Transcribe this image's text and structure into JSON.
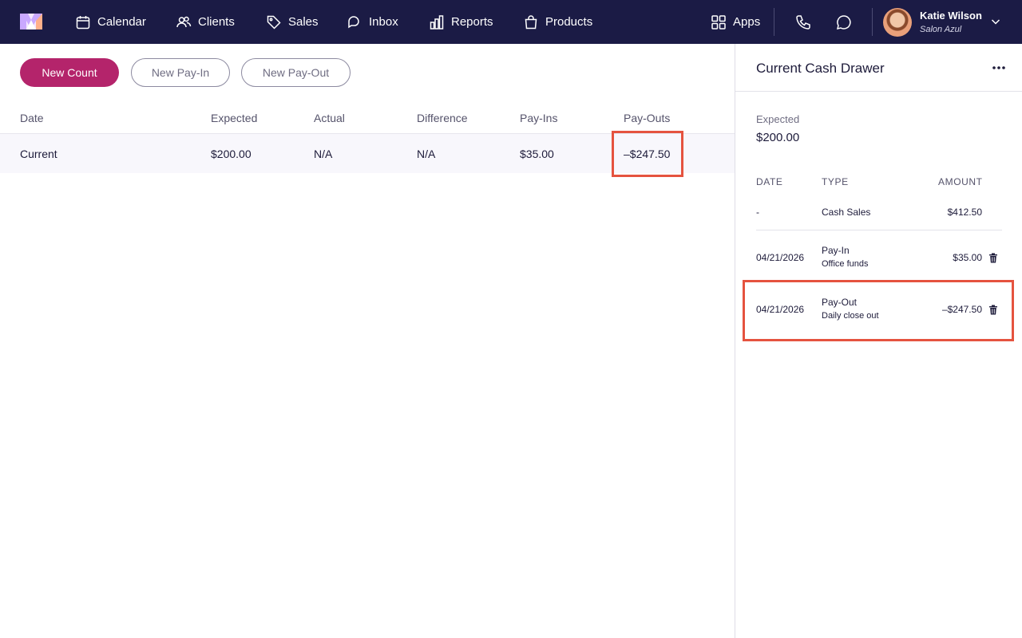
{
  "nav": {
    "items": [
      {
        "label": "Calendar",
        "icon": "calendar-icon"
      },
      {
        "label": "Clients",
        "icon": "clients-icon"
      },
      {
        "label": "Sales",
        "icon": "tag-icon"
      },
      {
        "label": "Inbox",
        "icon": "inbox-icon"
      },
      {
        "label": "Reports",
        "icon": "bar-chart-icon"
      },
      {
        "label": "Products",
        "icon": "shopping-bag-icon"
      }
    ],
    "apps_label": "Apps",
    "user": {
      "name": "Katie Wilson",
      "salon": "Salon Azul"
    }
  },
  "actions": {
    "new_count": "New Count",
    "new_pay_in": "New Pay-In",
    "new_pay_out": "New Pay-Out"
  },
  "table": {
    "columns": [
      "Date",
      "Expected",
      "Actual",
      "Difference",
      "Pay-Ins",
      "Pay-Outs"
    ],
    "rows": [
      {
        "date": "Current",
        "expected": "$200.00",
        "actual": "N/A",
        "difference": "N/A",
        "pay_ins": "$35.00",
        "pay_outs": "–$247.50"
      }
    ]
  },
  "drawer": {
    "title": "Current Cash Drawer",
    "expected_label": "Expected",
    "expected_value": "$200.00",
    "columns": [
      "DATE",
      "TYPE",
      "AMOUNT"
    ],
    "entries": [
      {
        "date": "-",
        "type": "Cash Sales",
        "note": "",
        "amount": "$412.50"
      },
      {
        "date": "04/21/2026",
        "type": "Pay-In",
        "note": "Office funds",
        "amount": "$35.00"
      },
      {
        "date": "04/21/2026",
        "type": "Pay-Out",
        "note": "Daily close out",
        "amount": "–$247.50"
      }
    ]
  },
  "colors": {
    "nav_bg": "#1b1b45",
    "primary": "#b4246b",
    "highlight": "#e5533f"
  }
}
